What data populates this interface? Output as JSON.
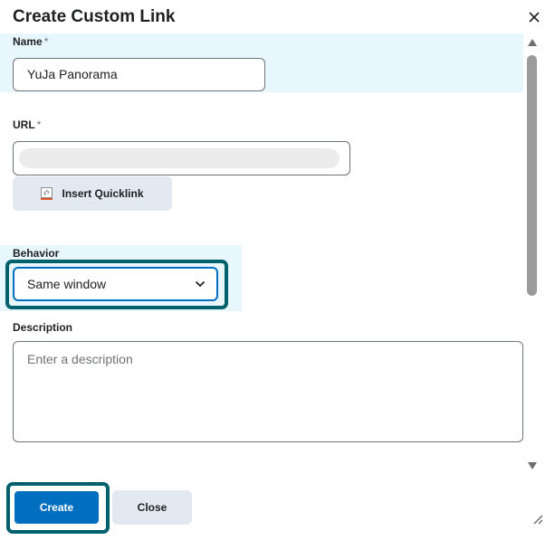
{
  "dialog": {
    "title": "Create Custom Link"
  },
  "fields": {
    "name": {
      "label": "Name",
      "required_mark": "*",
      "value": "YuJa Panorama"
    },
    "url": {
      "label": "URL",
      "required_mark": "*",
      "value": ""
    },
    "behavior": {
      "label": "Behavior",
      "selected": "Same window"
    },
    "description": {
      "label": "Description",
      "placeholder": "Enter a description",
      "value": ""
    }
  },
  "buttons": {
    "insert_quicklink": "Insert Quicklink",
    "create": "Create",
    "close": "Close"
  },
  "icons": {
    "close": "close-icon",
    "quicklink": "quicklink-icon",
    "dropdown": "chevron-down-icon",
    "resize": "resize-grip-icon"
  },
  "colors": {
    "primary": "#006fbf",
    "focus_ring": "#00616c",
    "highlight": "#e8f6fd",
    "secondary_button": "#e3e9f1"
  }
}
